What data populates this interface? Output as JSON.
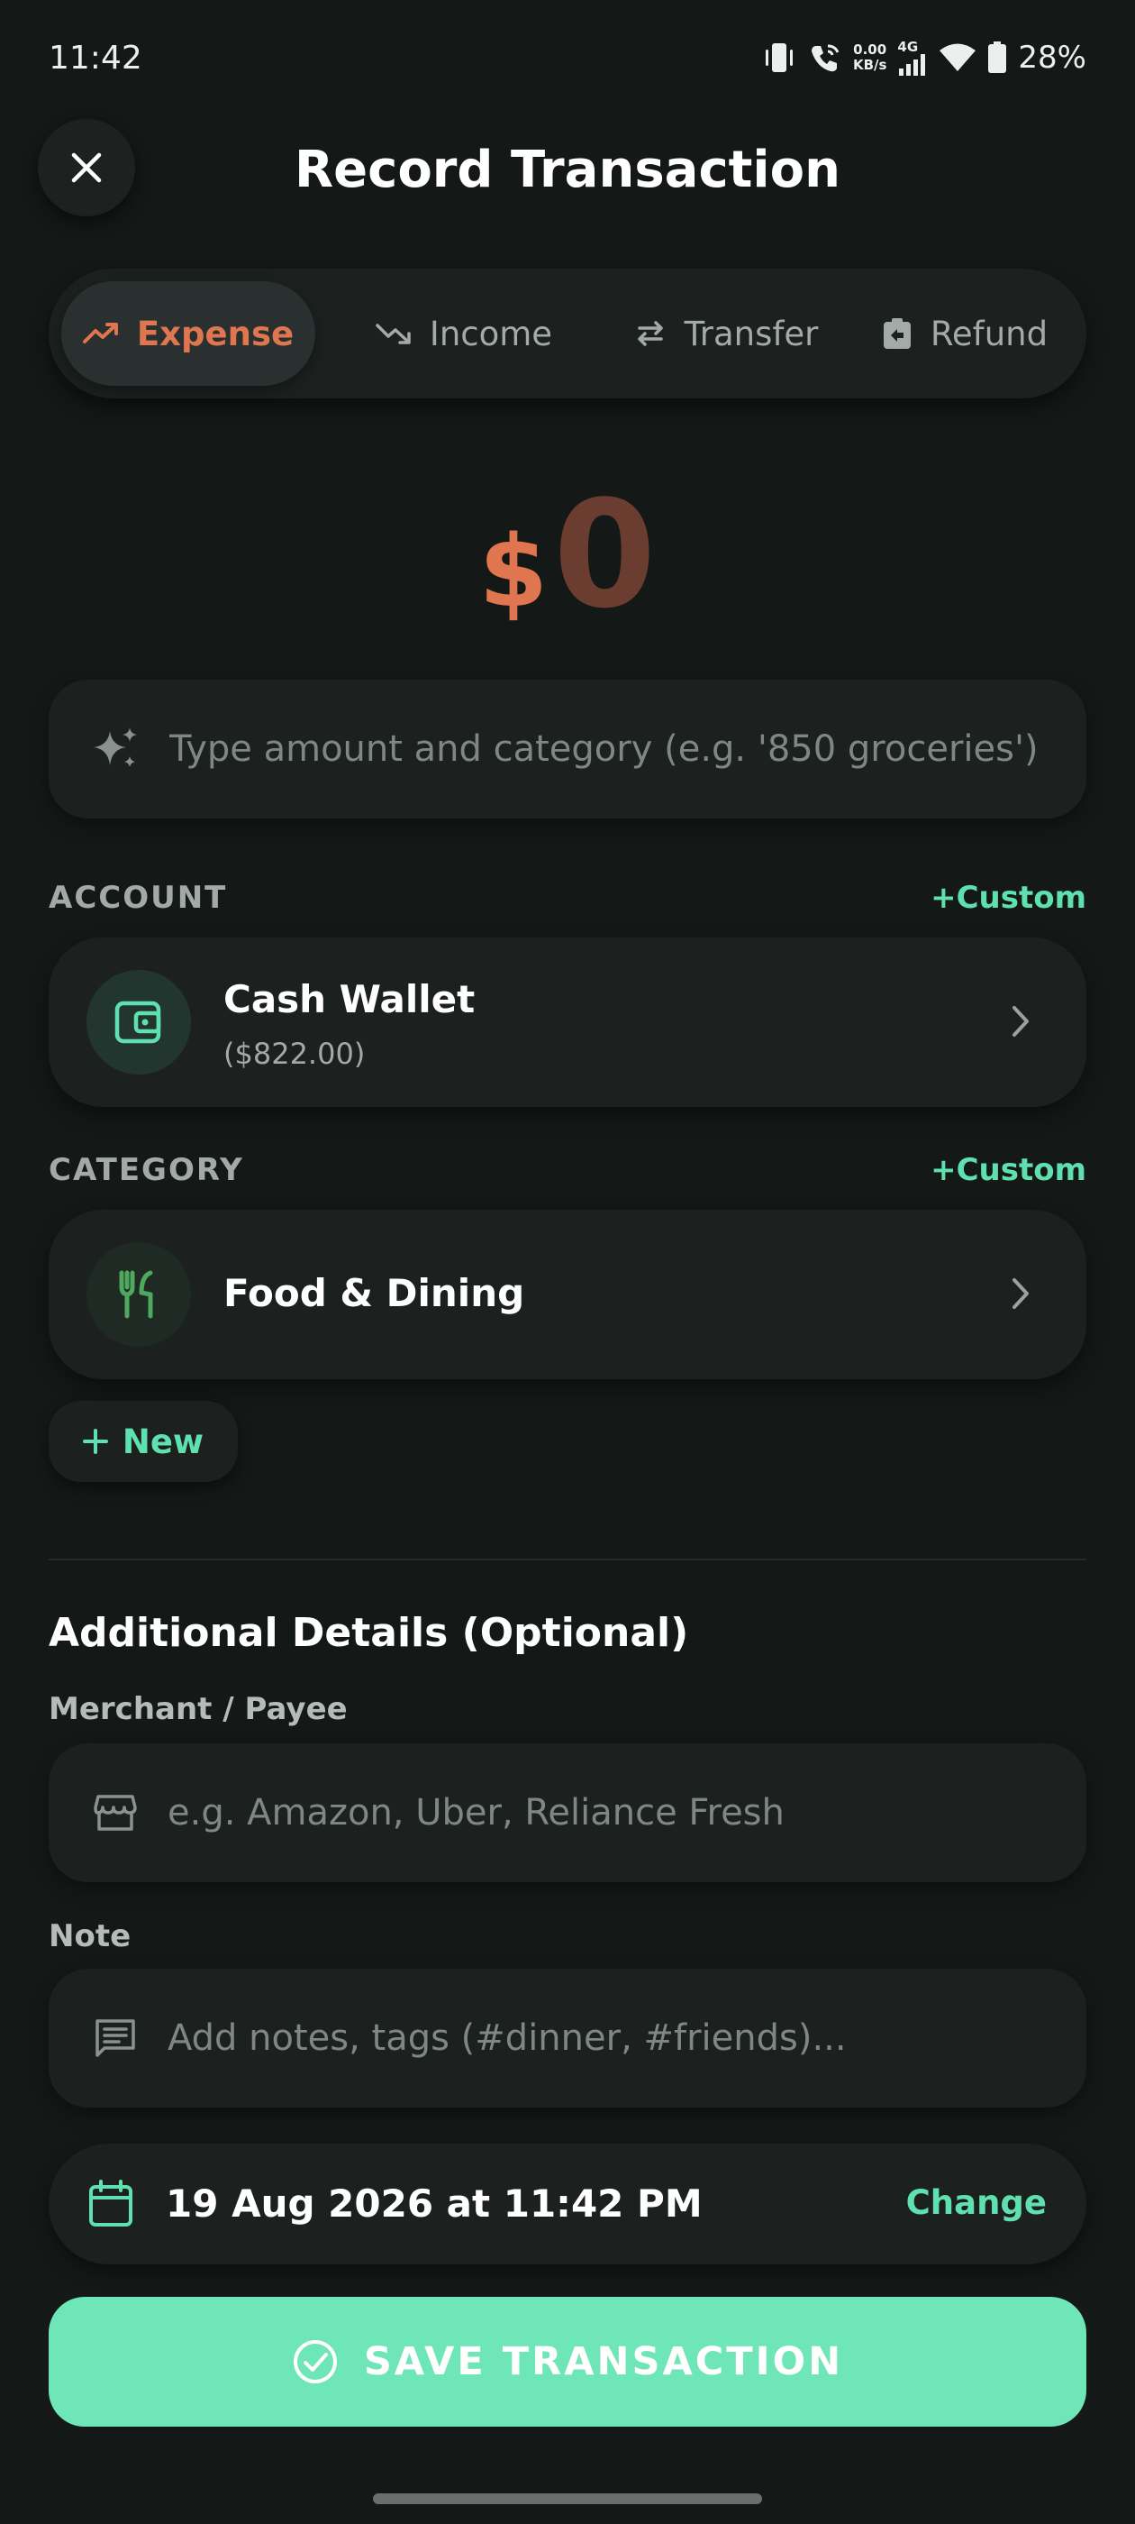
{
  "status_bar": {
    "time": "11:42",
    "net_speed": "0.00",
    "net_speed_unit": "KB/s",
    "network_type": "4G",
    "battery": "28%"
  },
  "header": {
    "title": "Record Transaction"
  },
  "tabs": [
    {
      "label": "Expense",
      "icon": "trending-up-icon",
      "active": true
    },
    {
      "label": "Income",
      "icon": "trending-down-icon",
      "active": false
    },
    {
      "label": "Transfer",
      "icon": "swap-icon",
      "active": false
    },
    {
      "label": "Refund",
      "icon": "refund-icon",
      "active": false
    }
  ],
  "amount": {
    "currency": "$",
    "value": "0"
  },
  "smart_input": {
    "placeholder": "Type amount and category (e.g. '850 groceries')"
  },
  "account": {
    "label": "ACCOUNT",
    "custom": "+Custom",
    "name": "Cash Wallet",
    "balance": "($822.00)"
  },
  "category": {
    "label": "CATEGORY",
    "custom": "+Custom",
    "name": "Food & Dining"
  },
  "new_button": {
    "label": "New"
  },
  "details": {
    "title": "Additional Details (Optional)",
    "merchant_label": "Merchant / Payee",
    "merchant_placeholder": "e.g. Amazon, Uber, Reliance Fresh",
    "note_label": "Note",
    "note_placeholder": "Add notes, tags (#dinner, #friends)..."
  },
  "date": {
    "value": "19 Aug 2026 at 11:42 PM",
    "change": "Change"
  },
  "save_button": {
    "label": "SAVE TRANSACTION"
  },
  "colors": {
    "background": "#141817",
    "accent_green": "#6ee6b7",
    "expense_orange": "#e07650"
  }
}
